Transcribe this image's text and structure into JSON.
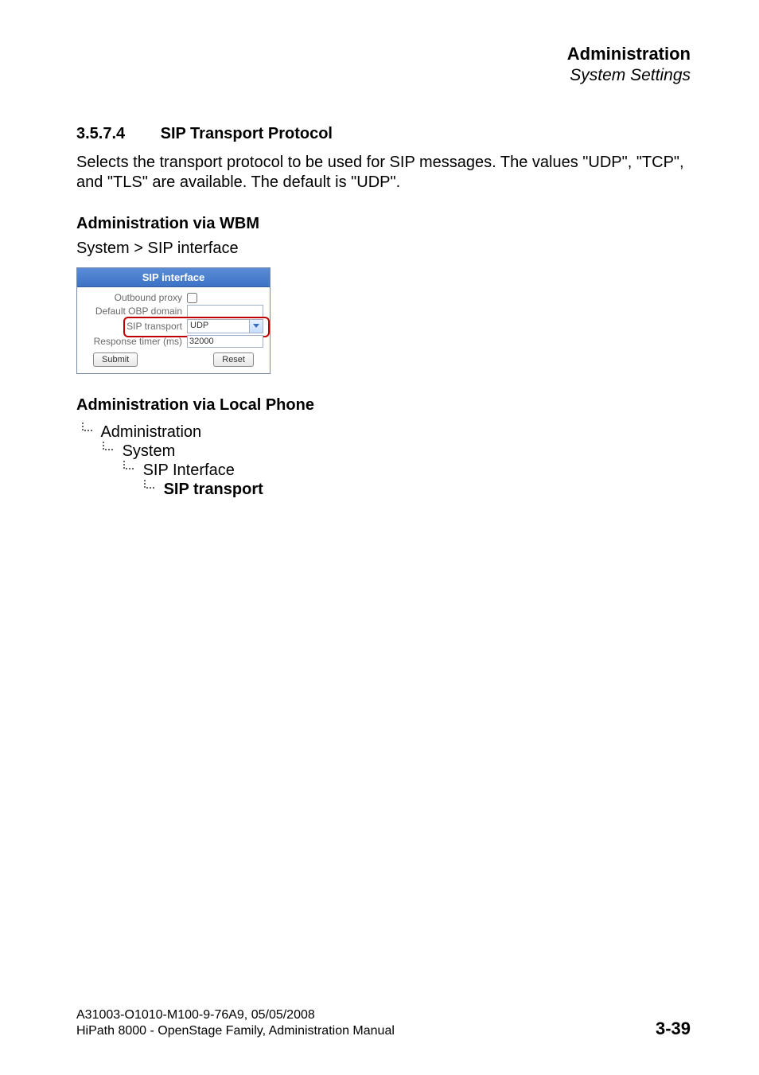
{
  "header": {
    "title": "Administration",
    "subtitle": "System Settings"
  },
  "section": {
    "number": "3.5.7.4",
    "title": "SIP Transport Protocol",
    "paragraph": "Selects the transport protocol to be used for SIP messages. The values \"UDP\", \"TCP\", and \"TLS\" are available. The default is \"UDP\"."
  },
  "wbm": {
    "heading": "Administration via WBM",
    "breadcrumb": "System > SIP interface",
    "panel": {
      "title": "SIP interface",
      "outbound_proxy_label": "Outbound proxy",
      "outbound_proxy_checked": false,
      "default_obp_label": "Default OBP domain",
      "default_obp_value": "",
      "sip_transport_label": "SIP transport",
      "sip_transport_value": "UDP",
      "response_timer_label": "Response timer (ms)",
      "response_timer_value": "32000",
      "submit_label": "Submit",
      "reset_label": "Reset"
    }
  },
  "local": {
    "heading": "Administration via Local Phone",
    "tree": {
      "l0": "Administration",
      "l1": "System",
      "l2": "SIP Interface",
      "l3": "SIP transport"
    }
  },
  "footer": {
    "line1": "A31003-O1010-M100-9-76A9, 05/05/2008",
    "line2": "HiPath 8000 - OpenStage Family, Administration Manual",
    "page": "3-39"
  }
}
